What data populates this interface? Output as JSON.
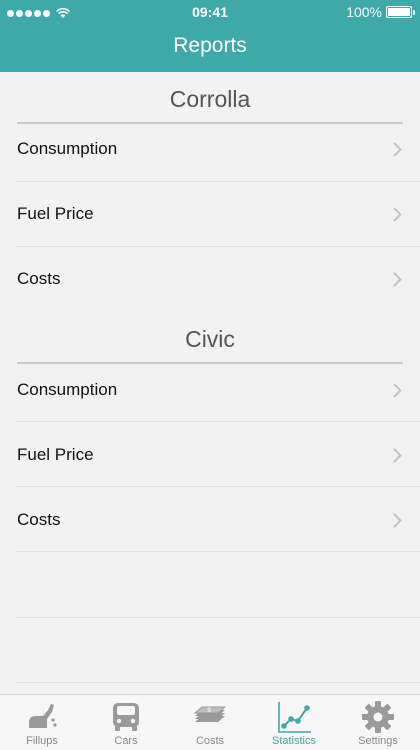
{
  "status": {
    "time": "09:41",
    "battery": "100%"
  },
  "header": {
    "title": "Reports"
  },
  "sections": [
    {
      "title": "Corrolla",
      "items": [
        "Consumption",
        "Fuel Price",
        "Costs"
      ]
    },
    {
      "title": "Civic",
      "items": [
        "Consumption",
        "Fuel Price",
        "Costs"
      ]
    }
  ],
  "tabbar": {
    "tabs": [
      {
        "label": "Fillups",
        "icon": "fuel-pump-icon"
      },
      {
        "label": "Cars",
        "icon": "car-icon"
      },
      {
        "label": "Costs",
        "icon": "money-icon"
      },
      {
        "label": "Statistics",
        "icon": "chart-icon"
      },
      {
        "label": "Settings",
        "icon": "gear-icon"
      }
    ],
    "active": "Statistics"
  },
  "colors": {
    "accent": "#3fa9a9",
    "background": "#f2f2f2",
    "icon_gray": "#9a9a9a"
  }
}
